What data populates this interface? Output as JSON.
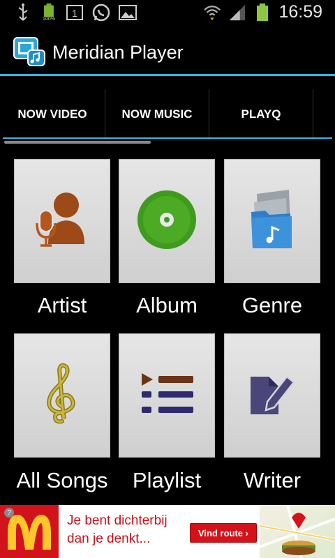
{
  "status_bar": {
    "time": "16:59",
    "battery_left_percent_label": "100%",
    "icons": [
      "usb-icon",
      "battery-icon",
      "notification-one-icon",
      "whatsapp-icon",
      "gallery-icon",
      "wifi-icon",
      "signal-icon",
      "battery-icon"
    ]
  },
  "action_bar": {
    "title": "Meridian Player",
    "accent_color": "#33b5e5"
  },
  "tabs": [
    {
      "label": "NOW VIDEO"
    },
    {
      "label": "NOW MUSIC"
    },
    {
      "label": "PLAYQ"
    }
  ],
  "grid": {
    "items": [
      {
        "label": "Artist",
        "icon": "artist-microphone-icon"
      },
      {
        "label": "Album",
        "icon": "album-disc-icon"
      },
      {
        "label": "Genre",
        "icon": "genre-folder-icon"
      },
      {
        "label": "All Songs",
        "icon": "treble-clef-icon"
      },
      {
        "label": "Playlist",
        "icon": "playlist-icon"
      },
      {
        "label": "Writer",
        "icon": "writer-pen-icon"
      }
    ]
  },
  "ad": {
    "line1": "Je bent dichterbij",
    "line2": "dan je denkt...",
    "button_label": "Vind route ›",
    "brand_color": "#d3131b"
  }
}
